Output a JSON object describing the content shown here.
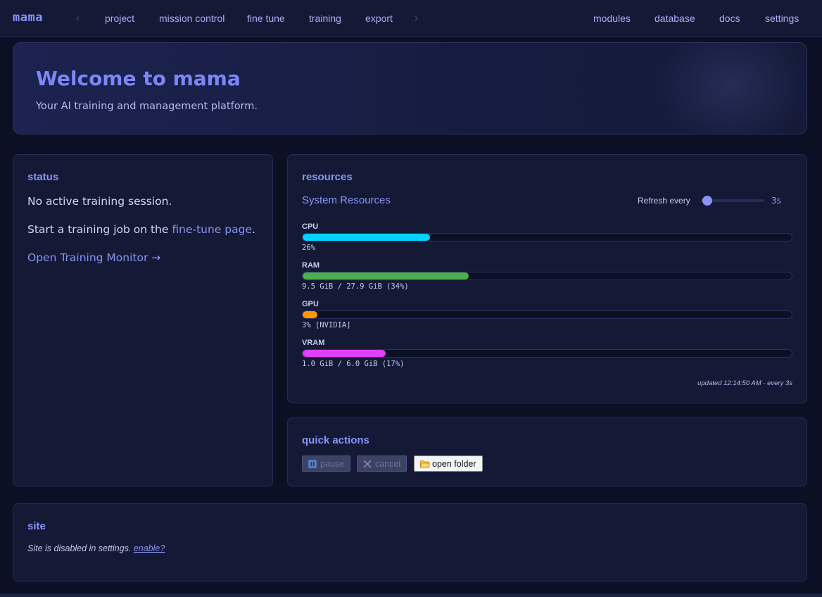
{
  "app": {
    "brand": "mama"
  },
  "nav": {
    "prev_icon": "chevron-left",
    "next_icon": "chevron-right",
    "left_links": [
      "project",
      "mission control",
      "fine tune",
      "training",
      "export"
    ],
    "right_links": [
      "modules",
      "database",
      "docs",
      "settings"
    ]
  },
  "hero": {
    "title": "Welcome to mama",
    "subtitle": "Your AI training and management platform."
  },
  "status": {
    "title": "status",
    "line1": "No active training session.",
    "line2_prefix": "Start a training job on the ",
    "line2_link": "fine-tune page",
    "line2_suffix": ".",
    "monitor_link": "Open Training Monitor →"
  },
  "resources": {
    "title": "resources",
    "subtitle": "System Resources",
    "refresh_label": "Refresh every",
    "refresh_value": "3s",
    "refresh_seconds": 3,
    "refresh_slider_fraction": 0.0,
    "items": [
      {
        "label": "CPU",
        "value": "26%",
        "fraction": 0.26,
        "color": "#00d2ff"
      },
      {
        "label": "RAM",
        "value": "9.5 GiB / 27.9 GiB (34%)",
        "fraction": 0.34,
        "color": "#4caf50"
      },
      {
        "label": "GPU",
        "value": "3% [NVIDIA]",
        "fraction": 0.03,
        "color": "#ff9800"
      },
      {
        "label": "VRAM",
        "value": "1.0 GiB / 6.0 GiB (17%)",
        "fraction": 0.17,
        "color": "#e040fb"
      }
    ],
    "updated": "updated 12:14:50 AM · every 3s"
  },
  "quick_actions": {
    "title": "quick actions",
    "pause_label": "pause",
    "pause_icon": "pause-icon",
    "cancel_label": "cancel",
    "cancel_icon": "x-icon",
    "open_folder_label": "open folder",
    "open_folder_icon": "folder-icon"
  },
  "site": {
    "title": "site",
    "text": "Site is disabled in settings.",
    "enable_link": "enable?"
  },
  "colors": {
    "accent": "#8b93f5",
    "background": "#0b1024",
    "card": "#141a36"
  }
}
